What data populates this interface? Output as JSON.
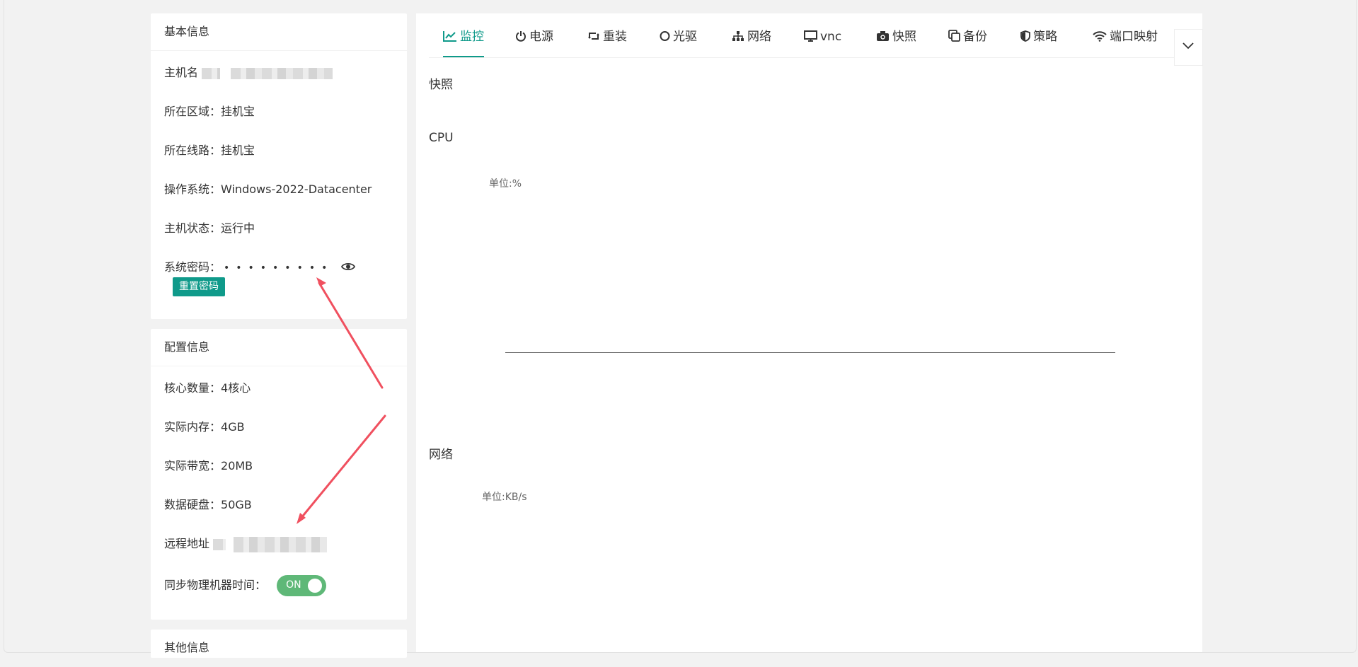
{
  "basic": {
    "title": "基本信息",
    "hostname_label": "主机名",
    "region_label": "所在区域：",
    "region_value": "挂机宝",
    "line_label": "所在线路：",
    "line_value": "挂机宝",
    "os_label": "操作系统：",
    "os_value": "Windows-2022-Datacenter",
    "status_label": "主机状态：",
    "status_value": "运行中",
    "password_label": "系统密码：",
    "password_mask": "•••••••••",
    "reset_button": "重置密码"
  },
  "config": {
    "title": "配置信息",
    "cores_label": "核心数量：",
    "cores_value": "4核心",
    "memory_label": "实际内存：",
    "memory_value": "4GB",
    "bandwidth_label": "实际带宽：",
    "bandwidth_value": "20MB",
    "disk_label": "数据硬盘：",
    "disk_value": "50GB",
    "remote_label": "远程地址",
    "sync_label": "同步物理机器时间：",
    "sync_state": "ON"
  },
  "other": {
    "title": "其他信息"
  },
  "tabs": [
    {
      "label": "监控",
      "icon": "line-chart-icon"
    },
    {
      "label": "电源",
      "icon": "power-icon"
    },
    {
      "label": "重装",
      "icon": "retweet-icon"
    },
    {
      "label": "光驱",
      "icon": "disc-icon"
    },
    {
      "label": "网络",
      "icon": "sitemap-icon"
    },
    {
      "label": "vnc",
      "icon": "desktop-icon"
    },
    {
      "label": "快照",
      "icon": "camera-icon"
    },
    {
      "label": "备份",
      "icon": "copy-icon"
    },
    {
      "label": "策略",
      "icon": "shield-icon"
    },
    {
      "label": "端口映射",
      "icon": "wifi-icon"
    }
  ],
  "monitor": {
    "snapshot_title": "快照",
    "cpu_title": "CPU",
    "cpu_unit": "单位:%",
    "network_title": "网络",
    "network_unit": "单位:KB/s"
  },
  "colors": {
    "accent": "#0f9a8a",
    "switch_on": "#5fb878",
    "annotation_arrow": "#f0505f"
  }
}
